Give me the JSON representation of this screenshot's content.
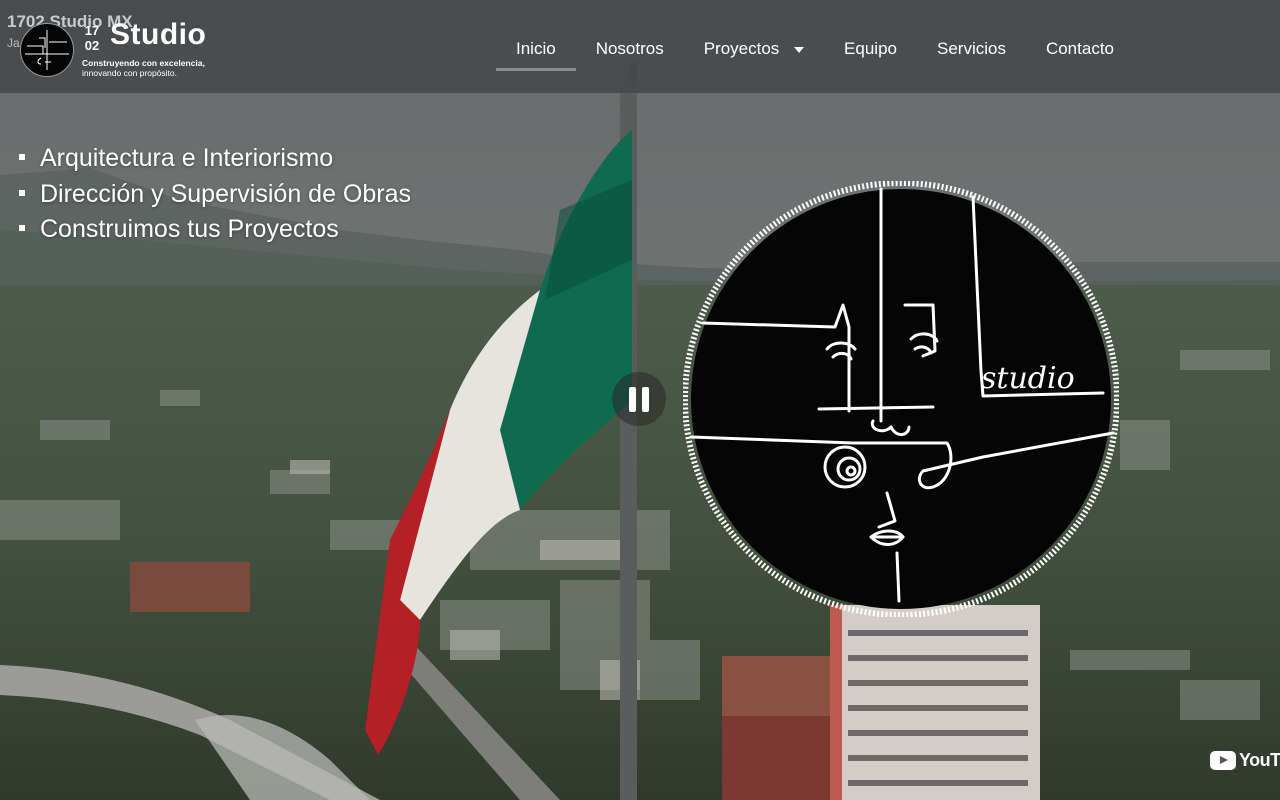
{
  "video_overlay": {
    "title": "1702 Studio MX",
    "channel": "Ja... ...sio"
  },
  "logo": {
    "number_top": "17",
    "number_bottom": "02",
    "word": "Studio",
    "tagline_line1": "Construyendo con excelencia,",
    "tagline_line2": "innovando con propósito."
  },
  "nav": {
    "items": [
      {
        "label": "Inicio",
        "active": true
      },
      {
        "label": "Nosotros"
      },
      {
        "label": "Proyectos",
        "has_dropdown": true
      },
      {
        "label": "Equipo"
      },
      {
        "label": "Servicios"
      },
      {
        "label": "Contacto"
      }
    ]
  },
  "hero": {
    "services": [
      "Arquitectura e Interiorismo",
      "Dirección y Supervisión de Obras",
      "Construimos tus Proyectos"
    ]
  },
  "emblem": {
    "script_text": "studio"
  },
  "player": {
    "pause_icon": "pause-icon",
    "watermark": "YouTube"
  },
  "colors": {
    "header_bg": "#46484a",
    "nav_active_underline": "#8a8e92",
    "flag_green": "#0f6b4f",
    "flag_red": "#b51f26",
    "emblem_bg": "#050505"
  }
}
